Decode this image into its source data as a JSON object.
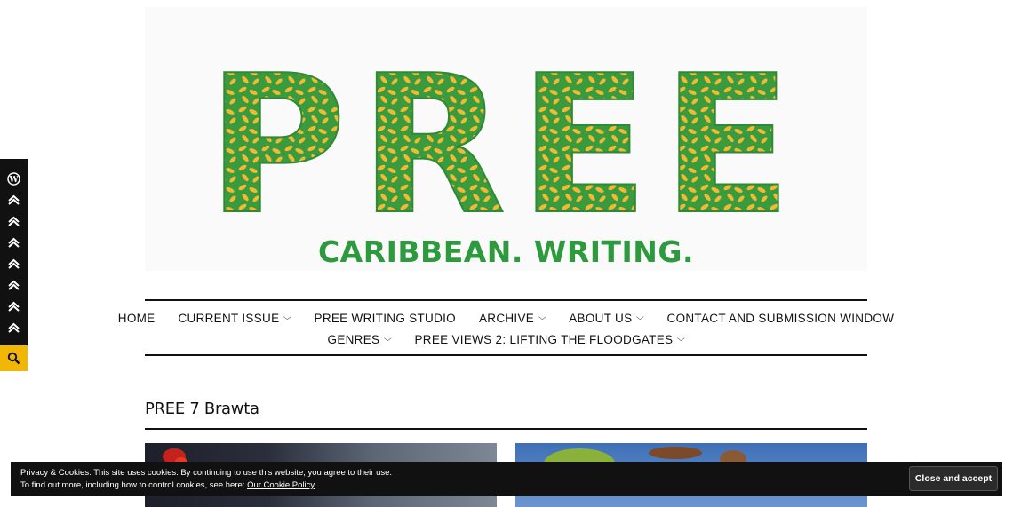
{
  "site": {
    "logo_text": "PREE",
    "tagline": "CARIBBEAN. WRITING."
  },
  "nav": {
    "row1": [
      {
        "label": "HOME",
        "has_submenu": false
      },
      {
        "label": "CURRENT ISSUE",
        "has_submenu": true
      },
      {
        "label": "PREE WRITING STUDIO",
        "has_submenu": false
      },
      {
        "label": "ARCHIVE",
        "has_submenu": true
      },
      {
        "label": "ABOUT US",
        "has_submenu": true
      },
      {
        "label": "CONTACT AND SUBMISSION WINDOW",
        "has_submenu": false
      }
    ],
    "row2": [
      {
        "label": "GENRES",
        "has_submenu": true
      },
      {
        "label": "PREE VIEWS 2: LIFTING THE FLOODGATES",
        "has_submenu": true
      }
    ]
  },
  "page": {
    "title": "PREE 7 Brawta"
  },
  "sidebar": {
    "icons": [
      "wordpress-icon",
      "share-icon",
      "share-icon",
      "share-icon",
      "share-icon",
      "share-icon",
      "share-icon",
      "share-icon"
    ],
    "search_icon": "search-icon"
  },
  "cookie_bar": {
    "line1": "Privacy & Cookies: This site uses cookies. By continuing to use this website, you agree to their use.",
    "line2_prefix": "To find out more, including how to control cookies, see here: ",
    "link_text": "Our Cookie Policy",
    "button_label": "Close and accept"
  },
  "colors": {
    "logo_green": "#3a9a3e",
    "logo_yellow": "#f2b933",
    "search_tab": "#f2b705",
    "dark": "#111111"
  }
}
